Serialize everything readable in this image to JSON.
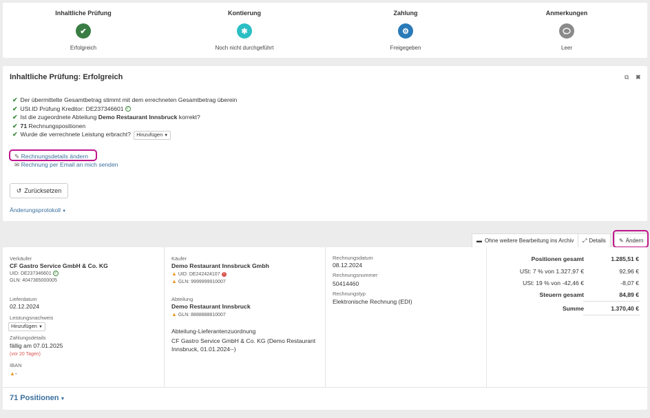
{
  "steps": [
    {
      "title": "Inhaltliche Prüfung",
      "status": "Erfolgreich",
      "icon": "check-icon",
      "color": "#3a7d44"
    },
    {
      "title": "Kontierung",
      "status": "Noch nicht durchgeführt",
      "icon": "asterisk-icon",
      "color": "#2bbec4"
    },
    {
      "title": "Zahlung",
      "status": "Freigegeben",
      "icon": "gears-icon",
      "color": "#2a7ab8"
    },
    {
      "title": "Anmerkungen",
      "status": "Leer",
      "icon": "comment-icon",
      "color": "#8a8a8a"
    }
  ],
  "review": {
    "title": "Inhaltliche Prüfung: Erfolgreich",
    "checks": {
      "c1": "Der übermittelte Gesamtbetrag stimmt mit dem errechneten Gesamtbetrag überein",
      "c2_prefix": "USt.ID Prüfung Kreditor: ",
      "c2_value": "DE237346601",
      "c3_prefix": "Ist die zugeordnete Abteilung ",
      "c3_bold": "Demo Restaurant Innsbruck",
      "c3_suffix": " korrekt?",
      "c4_bold": "71",
      "c4_suffix": " Rechnungspositionen",
      "c5_prefix": "Wurde die verrechnete Leistung erbracht? ",
      "c5_button": "Hinzufügen"
    },
    "edit_details_link": "Rechnungsdetails ändern",
    "email_link": "Rechnung per Email an mich senden",
    "reset_button": "Zurücksetzen",
    "changelog_link": "Änderungsprotokoll"
  },
  "toolbar": {
    "archive_button": "Ohne weitere Bearbeitung ins Archiv",
    "details_button": "Details",
    "edit_button": "Ändern"
  },
  "seller": {
    "label": "Verkäufer",
    "name": "CF Gastro Service GmbH & Co. KG",
    "uid": "UID: DE237346601",
    "gln": "GLN: 4047365000005",
    "delivery_label": "Lieferdatum",
    "delivery_date": "02.12.2024",
    "proof_label": "Leistungsnachweis",
    "proof_button": "Hinzufügen",
    "payment_label": "Zahlungsdetails",
    "payment_due": "fällig am 07.01.2025",
    "payment_overdue": "(vor 20 Tagen)",
    "iban_label": "IBAN",
    "iban_value": "-"
  },
  "buyer": {
    "label": "Käufer",
    "name": "Demo Restaurant Innsbruck Gmbh",
    "uid": "UID: DE242424107",
    "gln": "GLN: 9999999910007",
    "dept_label": "Abteilung",
    "dept_name": "Demo Restaurant Innsbruck",
    "dept_gln": "GLN: 8888888810007",
    "assign_label": "Abteilung-Lieferantenzuordnung",
    "assign_line1": "CF Gastro Service GmbH & Co. KG (Demo Restaurant",
    "assign_line2": "Innsbruck, 01.01.2024--)"
  },
  "invoice": {
    "date_label": "Rechnungsdatum",
    "date": "08.12.2024",
    "number_label": "Rechnungsnummer",
    "number": "50414460",
    "type_label": "Rechnungstyp",
    "type": "Elektronische Rechnung (EDI)"
  },
  "totals": {
    "positions_label": "Positionen gesamt",
    "positions_value": "1.285,51 €",
    "vat7_label": "USt: 7 % von 1.327,97 €",
    "vat7_value": "92,96 €",
    "vat19_label": "USt: 19 % von -42,46 €",
    "vat19_value": "-8,07 €",
    "tax_label": "Steuern gesamt",
    "tax_value": "84,89 €",
    "sum_label": "Summe",
    "sum_value": "1.370,40 €"
  },
  "positions_toggle": "71 Positionen"
}
